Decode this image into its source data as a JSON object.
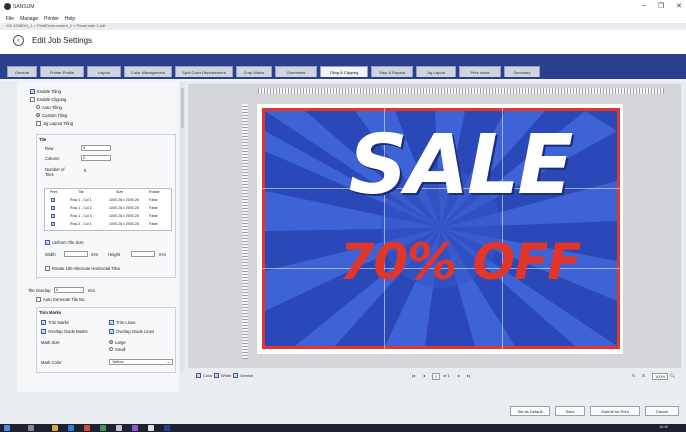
{
  "app": {
    "name": "SANSUM",
    "window_controls": [
      "–",
      "❐",
      "✕"
    ]
  },
  "menu": [
    "File",
    "Manage",
    "Printer",
    "Help"
  ],
  "path": "\\\\SI-1938DH_1 > PrintEnvironment_1 > Panel sale 1.pdf",
  "header": {
    "title": "Edit Job Settings"
  },
  "tabs": [
    "General",
    "Printer Profile",
    "Layout",
    "Color Management",
    "Spot Color Replacement",
    "Crop Marks",
    "Grommets",
    "Tiling & Clipping",
    "Step & Repeat",
    "Jig Layout",
    "Print notes",
    "Summary"
  ],
  "active_tab": "Tiling & Clipping",
  "tiling": {
    "enable_tiling": "Enable Tiling",
    "enable_clipping": "Enable Clipping",
    "auto_tiling": "Auto-Tiling",
    "custom_tiling": "Custom Tiling",
    "jig_layout_tiling": "Jig Layout Tiling",
    "tile_header": "Tile",
    "row_label": "Row",
    "row_value": "3",
    "column_label": "Column",
    "column_value": "2",
    "number_label": "Number of Tiles",
    "number_value": "6",
    "table_headers": [
      "Print",
      "Tile",
      "Size",
      "Rotate"
    ],
    "table_rows": [
      {
        "tile": "Row 1 - Col 1",
        "size": "1000.28 x 2000.28",
        "rotate": "False"
      },
      {
        "tile": "Row 1 - Col 2",
        "size": "1000.28 x 2000.28",
        "rotate": "False"
      },
      {
        "tile": "Row 1 - Col 3",
        "size": "1000.28 x 2000.28",
        "rotate": "False"
      },
      {
        "tile": "Row 2 - Col 1",
        "size": "1000.28 x 2000.28",
        "rotate": "False"
      }
    ],
    "uniform_tile_size": "Uniform Tile Size",
    "width_label": "Width",
    "height_label": "Height",
    "unit_mm": "mm",
    "rotate_alt": "Rotate 180 Alternate Horizontal Tiles",
    "tile_overlap_label": "Tile Overlap",
    "tile_overlap_value": "0",
    "auto_generate": "Auto Generate Tile No.",
    "trim_marks_header": "Trim Marks",
    "trim_marks": "Trim Marks",
    "trim_lines": "Trim Lines",
    "overlap_guide_marks": "Overlap Guide Marks",
    "overlap_guide_lines": "Overlap Guide Lines",
    "mark_size_label": "Mark Size",
    "mark_size_large": "Large",
    "mark_size_small": "Small",
    "mark_color_label": "Mark Color",
    "mark_color_value": "Yellow"
  },
  "preview": {
    "headline": "SALE",
    "subline": "70% OFF",
    "colors": {
      "poster_blue": "#2b48b8",
      "accent_red": "#e2362a"
    }
  },
  "bottom_bar": {
    "color": "Color",
    "white": "White",
    "varnish": "Varnish",
    "page_current": "1",
    "page_of": "of 1",
    "zoom": "100%"
  },
  "footer": {
    "set_default": "Set as Default",
    "save": "Save",
    "submit": "Submit for Print",
    "cancel": "Cancel"
  },
  "taskbar": {
    "time": "16:45"
  }
}
